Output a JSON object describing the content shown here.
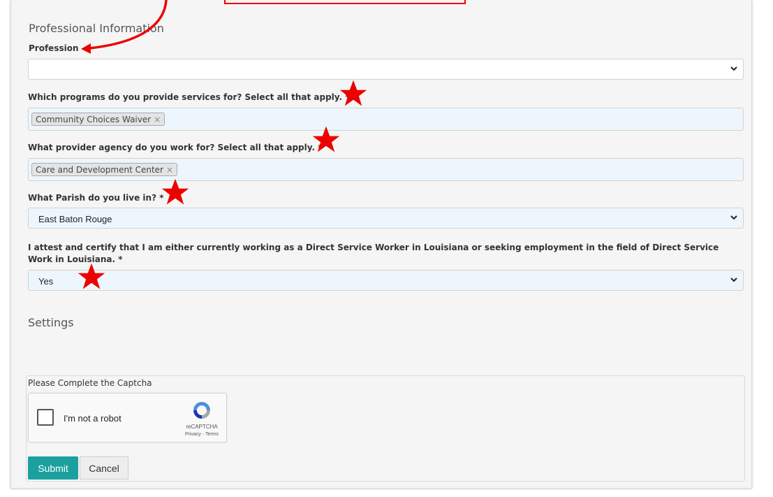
{
  "top_annotation_box": "",
  "professional": {
    "section_title": "Professional Information",
    "profession": {
      "label": "Profession",
      "value": ""
    },
    "programs": {
      "label": "Which programs do you provide services for? Select all that apply. *",
      "tags": [
        "Community Choices Waiver"
      ]
    },
    "agency": {
      "label": "What provider agency do you work for? Select all that apply. *",
      "tags": [
        "Care and Development Center"
      ]
    },
    "parish": {
      "label": "What Parish do you live in? *",
      "value": "East Baton Rouge"
    },
    "attest": {
      "label": "I attest and certify that I am either currently working as a Direct Service Worker in Louisiana or seeking employment in the field of Direct Service Work in Louisiana. *",
      "value": "Yes"
    }
  },
  "settings": {
    "section_title": "Settings"
  },
  "captcha": {
    "title": "Please Complete the Captcha",
    "checkbox_label": "I'm not a robot",
    "brand": "reCAPTCHA",
    "privacy": "Privacy",
    "separator": " - ",
    "terms": "Terms"
  },
  "buttons": {
    "submit": "Submit",
    "cancel": "Cancel"
  },
  "annotations": {
    "color": "#ee0000",
    "icons": [
      "arrow-annotation-icon",
      "star-icon"
    ]
  },
  "colors": {
    "accent": "#1aa09e",
    "field_fill": "#eef6fd",
    "panel": "#f5f5f5"
  }
}
